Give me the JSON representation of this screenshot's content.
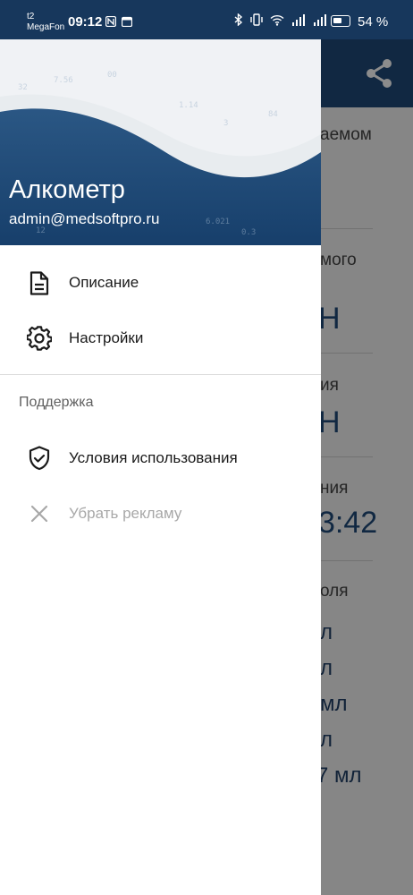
{
  "status_bar": {
    "carrier_line1": "t2",
    "carrier_line2": "MegaFon",
    "time": "09:12",
    "battery": "54 %"
  },
  "drawer": {
    "app_name": "Алкометр",
    "email": "admin@medsoftpro.ru",
    "items": [
      {
        "label": "Описание",
        "icon": "document-icon"
      },
      {
        "label": "Настройки",
        "icon": "gear-icon"
      }
    ],
    "section_title": "Поддержка",
    "support_items": [
      {
        "label": "Условия использования",
        "icon": "shield-check-icon"
      },
      {
        "label": "Убрать рекламу",
        "icon": "close-icon"
      }
    ]
  },
  "background": {
    "texts": [
      "аемом",
      "мого",
      "Н",
      "ия",
      "Н",
      "ния",
      "3:42",
      "оля",
      "л",
      "л",
      "мл",
      "л",
      "7 мл"
    ]
  }
}
